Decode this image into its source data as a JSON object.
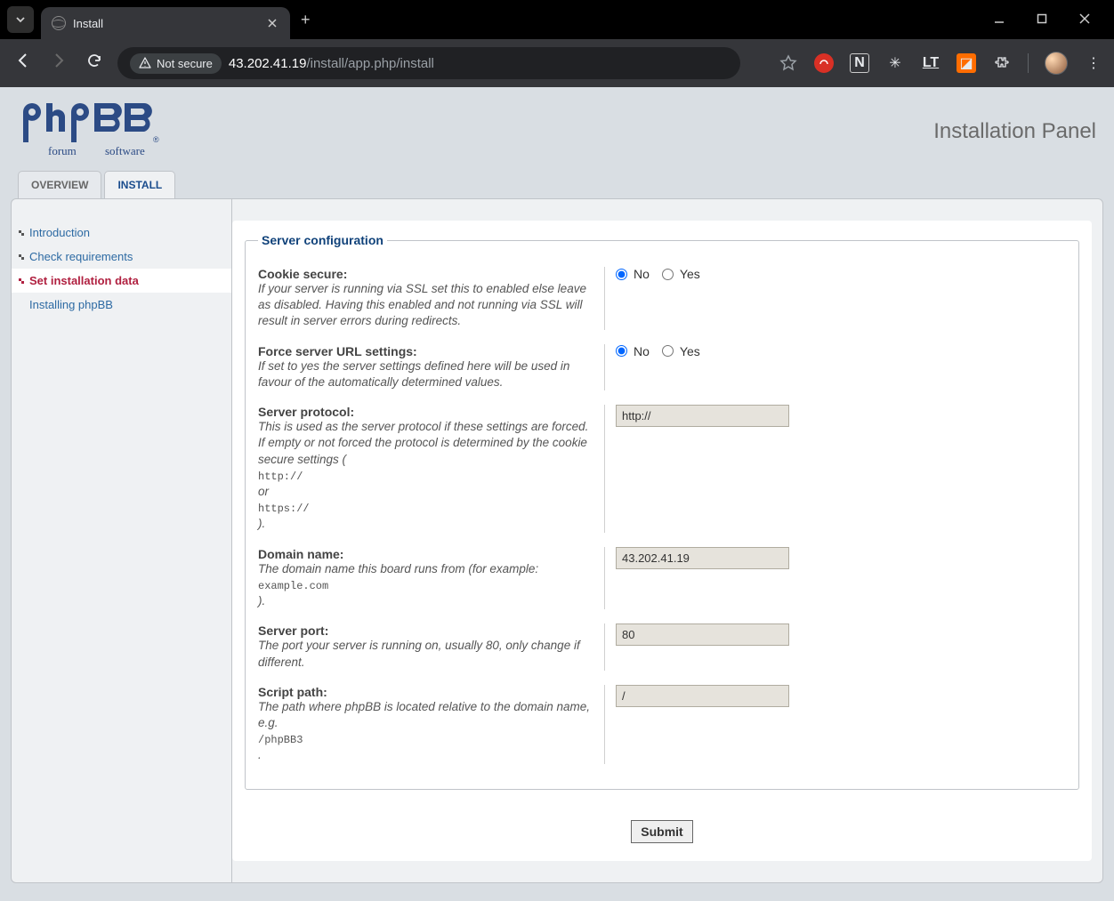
{
  "browser": {
    "tab_title": "Install",
    "security_label": "Not secure",
    "url_host": "43.202.41.19",
    "url_path": "/install/app.php/install"
  },
  "header": {
    "logo_alt": "phpBB forum software",
    "panel_title": "Installation Panel"
  },
  "tabs": [
    {
      "label": "OVERVIEW",
      "active": false
    },
    {
      "label": "INSTALL",
      "active": true
    }
  ],
  "sidebar": {
    "items": [
      {
        "label": "Introduction",
        "active": false,
        "icon": true
      },
      {
        "label": "Check requirements",
        "active": false,
        "icon": true
      },
      {
        "label": "Set installation data",
        "active": true,
        "icon": true
      },
      {
        "label": "Installing phpBB",
        "active": false,
        "icon": false
      }
    ]
  },
  "form": {
    "legend": "Server configuration",
    "cookie_secure": {
      "label": "Cookie secure:",
      "help": "If your server is running via SSL set this to enabled else leave as disabled. Having this enabled and not running via SSL will result in server errors during redirects.",
      "no": "No",
      "yes": "Yes",
      "value": "No"
    },
    "force_server": {
      "label": "Force server URL settings:",
      "help": "If set to yes the server settings defined here will be used in favour of the automatically determined values.",
      "no": "No",
      "yes": "Yes",
      "value": "No"
    },
    "server_protocol": {
      "label": "Server protocol:",
      "help_pre": "This is used as the server protocol if these settings are forced. If empty or not forced the protocol is determined by the cookie secure settings (",
      "code1": "http://",
      "mid": " or ",
      "code2": "https://",
      "help_post": ").",
      "value": "http://"
    },
    "domain_name": {
      "label": "Domain name:",
      "help_pre": "The domain name this board runs from (for example: ",
      "code": "example.com",
      "help_post": ").",
      "value": "43.202.41.19"
    },
    "server_port": {
      "label": "Server port:",
      "help": "The port your server is running on, usually 80, only change if different.",
      "value": "80"
    },
    "script_path": {
      "label": "Script path:",
      "help_pre": "The path where phpBB is located relative to the domain name, e.g. ",
      "code": "/phpBB3",
      "help_post": ".",
      "value": "/"
    },
    "submit": "Submit"
  }
}
